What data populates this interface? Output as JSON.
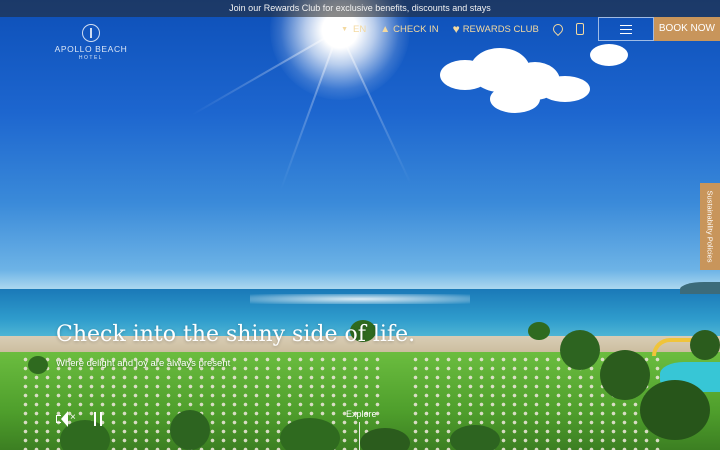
{
  "promo_banner": "Join our Rewards Club for exclusive benefits, discounts and stays",
  "logo": {
    "name": "APOLLO BEACH",
    "subtitle": "HOTEL"
  },
  "nav": {
    "language": "EN",
    "check_in": "CHECK IN",
    "rewards_club": "REWARDS CLUB",
    "book_now": "BOOK NOW"
  },
  "side_tab": "Sustainability Policies",
  "hero": {
    "headline": "Check into the shiny side of life.",
    "subline": "Where delight and joy are always present",
    "explore": "Explore"
  },
  "icons": {
    "lang": "chevron-down-icon",
    "check_in": "bell-icon",
    "rewards": "heart-icon",
    "location": "map-pin-icon",
    "phone": "phone-icon",
    "menu": "hamburger-icon",
    "mute": "mute-icon",
    "pause": "pause-icon"
  },
  "colors": {
    "accent": "#c8955b",
    "nav_text": "#f3d9a0"
  }
}
